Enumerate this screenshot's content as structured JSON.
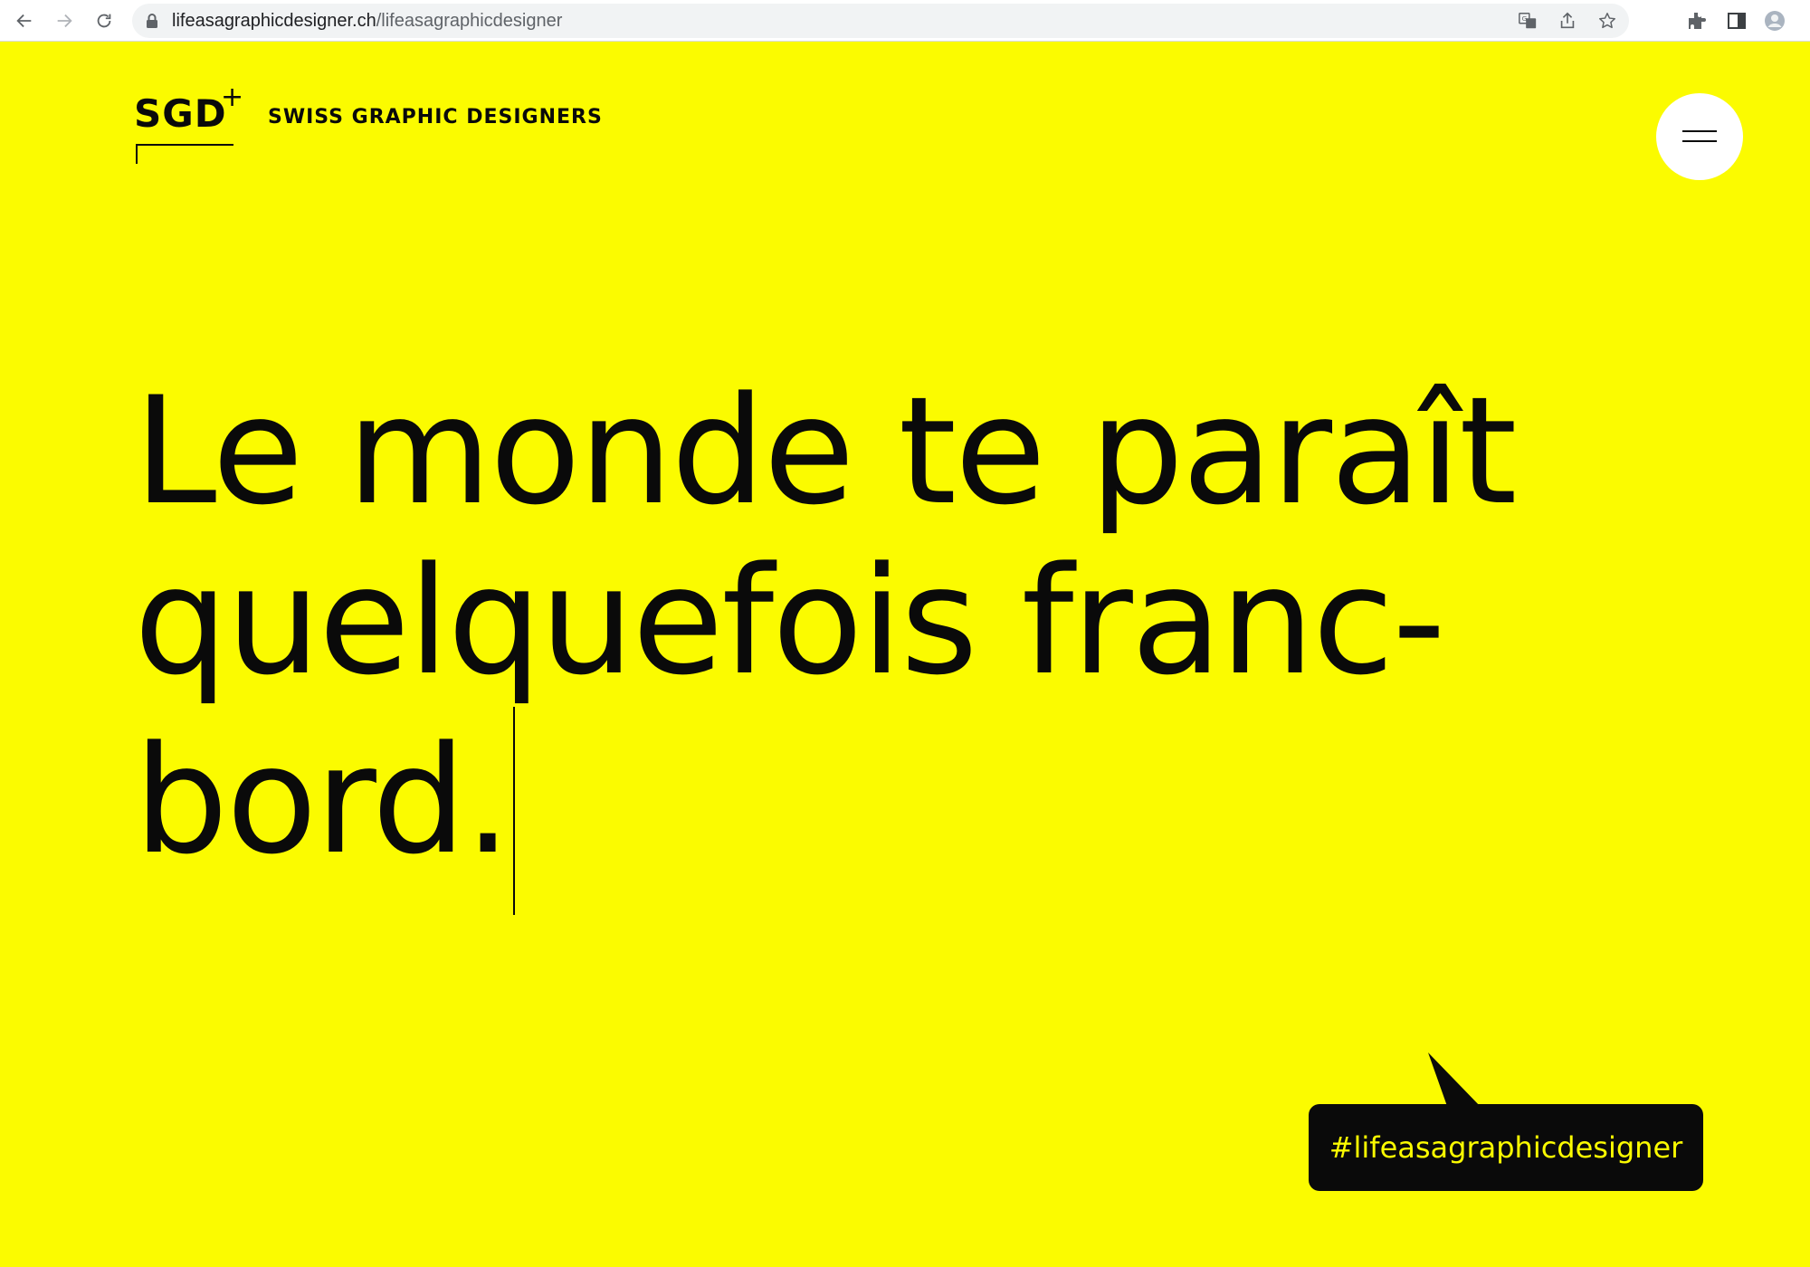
{
  "browser": {
    "url_domain": "lifeasagraphicdesigner.ch",
    "url_path": "/lifeasagraphicdesigner",
    "icons": [
      "back-icon",
      "forward-icon",
      "reload-icon",
      "lock-icon",
      "translate-icon",
      "share-icon",
      "star-icon",
      "extensions-icon",
      "side-panel-icon",
      "profile-icon"
    ]
  },
  "header": {
    "logo_mark": "SGD",
    "logo_plus": "+",
    "logo_text": "SWISS GRAPHIC DESIGNERS",
    "menu_icon": "hamburger-icon"
  },
  "headline": {
    "line1": "Le monde te paraît",
    "line2": "quelquefois franc-",
    "line3": "bord."
  },
  "hashtag": {
    "label": "#lifeasagraphicdesigner"
  },
  "colors": {
    "background": "#fbfb00",
    "text": "#0a0a0a",
    "bubble": "#0a0a0a",
    "bubble_text": "#fbfb00",
    "menu_button": "#ffffff"
  }
}
